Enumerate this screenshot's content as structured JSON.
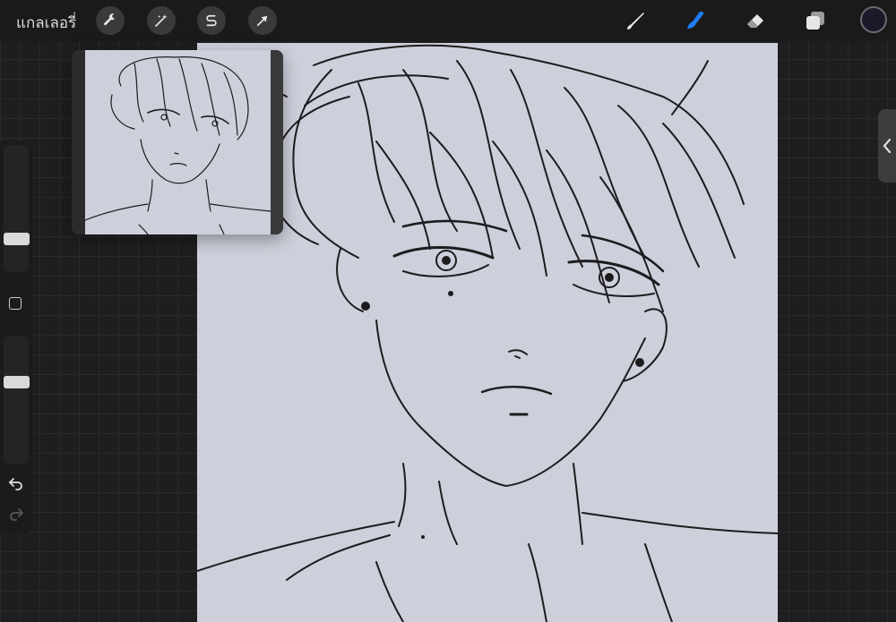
{
  "toolbar": {
    "gallery_label": "แกลเลอรี่",
    "left_tools": [
      "wrench-icon",
      "magic-wand-icon",
      "selection-s-icon",
      "transform-arrow-icon"
    ],
    "right_tools": [
      "brush-icon",
      "smudge-icon",
      "eraser-icon",
      "layers-icon"
    ],
    "active_tool": "smudge",
    "accent_color": "#1e7cf2",
    "current_color": "#1a1a2a"
  },
  "sidebar": {
    "brush_size_level": 0.25,
    "opacity_level": 0.35
  },
  "reference_window": {
    "visible": true
  },
  "canvas": {
    "background": "#cdd0db",
    "content": "line-art-portrait"
  }
}
